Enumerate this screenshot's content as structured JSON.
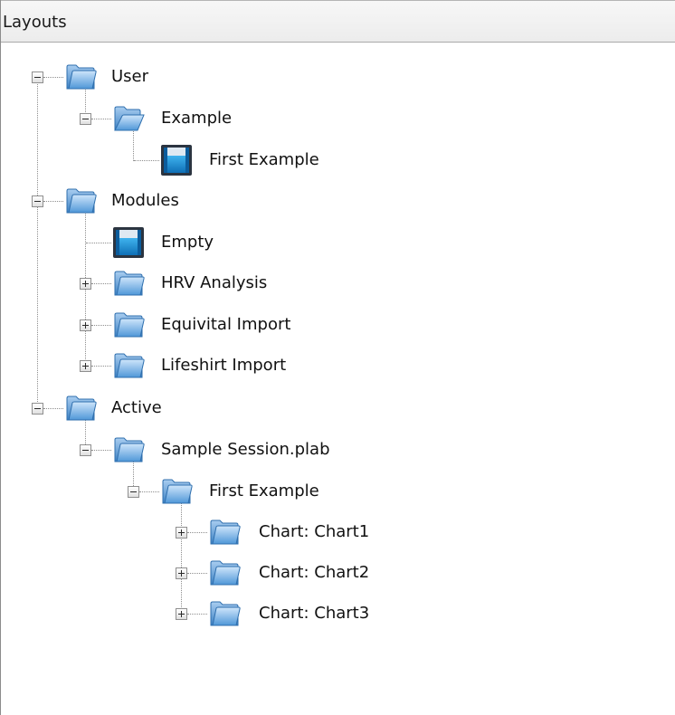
{
  "panel": {
    "title": "Layouts"
  },
  "tree": {
    "user": {
      "label": "User",
      "expander": "collapse"
    },
    "example": {
      "label": "Example",
      "expander": "collapse"
    },
    "first_example_layout": {
      "label": "First Example"
    },
    "modules": {
      "label": "Modules",
      "expander": "collapse"
    },
    "empty": {
      "label": "Empty"
    },
    "hrv_analysis": {
      "label": "HRV Analysis",
      "expander": "expand"
    },
    "equivital_import": {
      "label": "Equivital Import",
      "expander": "expand"
    },
    "lifeshirt_import": {
      "label": "Lifeshirt Import",
      "expander": "expand"
    },
    "active": {
      "label": "Active",
      "expander": "collapse"
    },
    "sample_session": {
      "label": "Sample Session.plab",
      "expander": "collapse"
    },
    "first_example_active": {
      "label": "First Example",
      "expander": "collapse"
    },
    "chart1": {
      "label": "Chart: Chart1",
      "expander": "expand"
    },
    "chart2": {
      "label": "Chart: Chart2",
      "expander": "expand"
    },
    "chart3": {
      "label": "Chart: Chart3",
      "expander": "expand"
    }
  },
  "icons": {
    "folder": "folder-icon",
    "folder_open": "folder-open-icon",
    "layout": "layout-icon",
    "expand": "plus-icon",
    "collapse": "minus-icon"
  },
  "colors": {
    "folder_light": "#cfe6fb",
    "folder_dark": "#4f97d8",
    "layout_water": "#1e8fd6",
    "layout_frame": "#2b3440",
    "connector": "#8e8e8e"
  }
}
